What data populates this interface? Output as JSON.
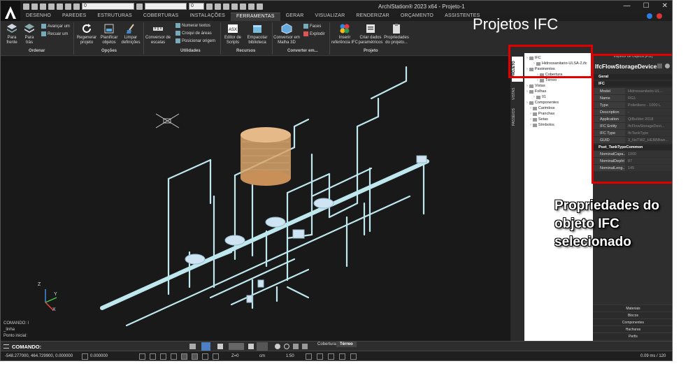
{
  "window": {
    "title": "ArchiStation® 2023 x64 - Projeto-1",
    "layer_value": "0",
    "scale_value": "0"
  },
  "menu": [
    "DESENHO",
    "PAREDES",
    "ESTRUTURAS",
    "COBERTURAS",
    "INSTALAÇÕES",
    "FERRAMENTAS",
    "GERAR",
    "VISUALIZAR",
    "RENDERIZAR",
    "ORÇAMENTO",
    "ASSISTENTES"
  ],
  "menu_active": "FERRAMENTAS",
  "ribbon": {
    "para_frente": "Para\nfrente",
    "para_tras": "Para\ntrás",
    "avancar": "Avançar um",
    "recuar": "Recuar um",
    "regenerar": "Regenerar\nprojeto",
    "planificar": "Planificar\nobjetos",
    "limpar": "Limpar\ndefinições",
    "conversor_escalas": "Conversor de\nescalas",
    "numerar": "Numerar textos",
    "croqui": "Croqui de áreas",
    "posicionar": "Posicionar origem",
    "editor": "Editor de\nScripts",
    "empacotar": "Empacotar\nbiblioteca",
    "conversor_3d": "Conversor em\nMalha 3D",
    "faces": "Faces",
    "explodir": "Explodir",
    "inserir_ifc": "Inserir\nreferência IFC",
    "criar_dados": "Criar dados\nparamétricos",
    "propriedades": "Propriedades\ndo projeto...",
    "groups": {
      "ordenar": "Ordenar",
      "opcoes": "Opções",
      "utilidades": "Utilidades",
      "recursos": "Recursos",
      "converter": "Converter em...",
      "projeto": "Projeto"
    }
  },
  "annotations": {
    "projetos_ifc": "Projetos IFC",
    "propriedades": "Propriedades do objeto IFC selecionado"
  },
  "side_tabs": [
    "PROJETO",
    "VISTAS",
    "PASSEIOS"
  ],
  "tree": [
    {
      "label": "IFC",
      "indent": 0
    },
    {
      "label": "Hidrossanitario-ULSA-2.ifc",
      "indent": 2
    },
    {
      "label": "Pavimentos",
      "indent": 0
    },
    {
      "label": "Cobertura",
      "indent": 3
    },
    {
      "label": "Térreo",
      "indent": 3
    },
    {
      "label": "Vistas",
      "indent": 0
    },
    {
      "label": "Folhas",
      "indent": 0
    },
    {
      "label": "01",
      "indent": 2
    },
    {
      "label": "Componentes",
      "indent": 0
    },
    {
      "label": "Carimbos",
      "indent": 1
    },
    {
      "label": "Pranchas",
      "indent": 1
    },
    {
      "label": "Setas",
      "indent": 1
    },
    {
      "label": "Símbolos",
      "indent": 1
    }
  ],
  "inspector": {
    "header": "Inspetor de Objetos [F11]",
    "object": "IfcFlowStorageDevice",
    "sections": {
      "geral": "Geral",
      "ifc": "IFC",
      "pset": "Pset_TankTypeCommon"
    },
    "ifc_props": [
      {
        "k": "Model",
        "v": "Hidrossanitario-UL..."
      },
      {
        "k": "Name",
        "v": "RG1"
      },
      {
        "k": "Type",
        "v": "Polietileno - 1000 L"
      },
      {
        "k": "Description",
        "v": "-"
      },
      {
        "k": "Application",
        "v": "QiBuilder 2018"
      },
      {
        "k": "IFC Entity",
        "v": "IfcFlowStorageDevi..."
      },
      {
        "k": "IFC Type",
        "v": "IfcTankType"
      },
      {
        "k": "GUID",
        "v": "3_NsTWZ_HEBBBwe..."
      }
    ],
    "pset_props": [
      {
        "k": "NominalCapa...",
        "v": "1000"
      },
      {
        "k": "NominalDepht",
        "v": "87"
      },
      {
        "k": "NominalLeng...",
        "v": "145"
      }
    ],
    "bottom_buttons": [
      "Materiais",
      "Blocos",
      "Componentes",
      "Hachuras",
      "Perfis"
    ]
  },
  "command": {
    "history": [
      "COMANDO: l",
      "_linha",
      "Ponto inicial:"
    ],
    "prompt": "COMANDO:"
  },
  "view_tabs": [
    "Cobertura",
    "Térreo"
  ],
  "view_tab_active": "Térreo",
  "status": {
    "coords": "-548.277000, 464.729900, 0.000000",
    "angle": "0.000000",
    "z": "Z=0",
    "unit": "cm",
    "scale": "1:50",
    "fps": "0.09 ms / 120"
  },
  "axes": {
    "x": "X",
    "y": "Y",
    "z": "Z"
  },
  "colors": {
    "accent_red": "#e00000",
    "pipe": "#bfe7ee",
    "tank": "#d9a46b"
  }
}
